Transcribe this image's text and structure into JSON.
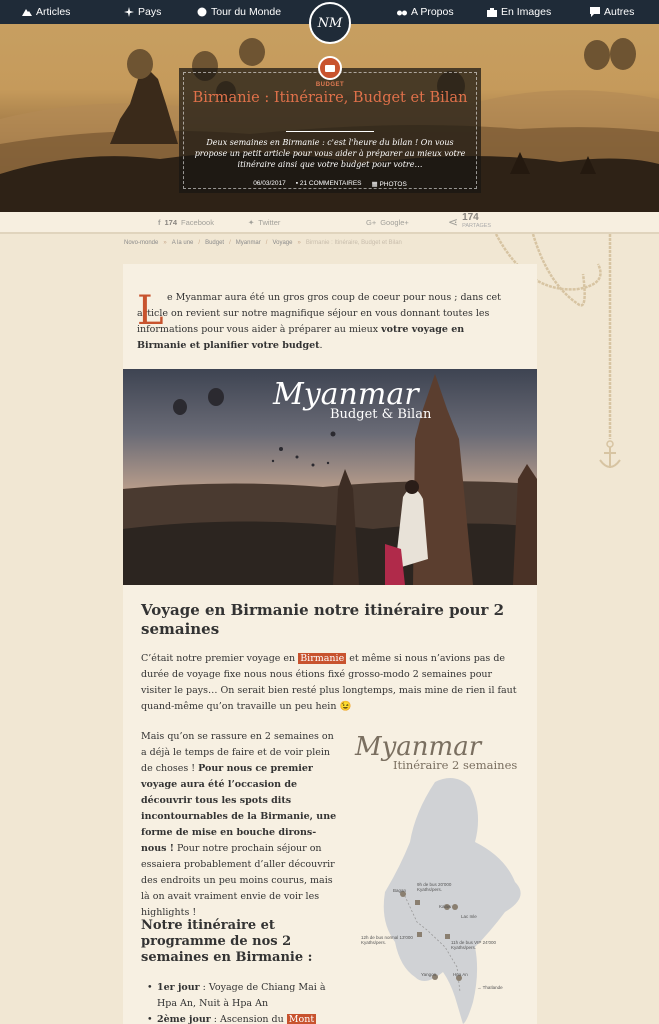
{
  "nav": {
    "articles": "Articles",
    "pays": "Pays",
    "tour": "Tour du Monde",
    "apropos": "A Propos",
    "images": "En Images",
    "autres": "Autres",
    "logo": "NM"
  },
  "hero": {
    "category": "BUDGET",
    "title": "Birmanie : Itinéraire, Budget et Bilan",
    "description": "Deux semaines en Birmanie : c'est l'heure du bilan ! On vous propose un petit article pour vous aider à préparer au mieux votre itinéraire ainsi que votre budget pour votre…",
    "date": "06/03/2017",
    "comments": "21 COMMENTAIRES",
    "photos": "PHOTOS"
  },
  "share": {
    "facebook_count": "174",
    "facebook_label": "Facebook",
    "twitter": "Twitter",
    "google": "Google+",
    "total": "174",
    "total_label": "PARTAGES"
  },
  "breadcrumb": {
    "home": "Novo-monde",
    "items": [
      "A la une",
      "Budget",
      "Myanmar",
      "Voyage"
    ],
    "current": "Birmanie : Itinéraire, Budget et Bilan"
  },
  "article": {
    "dropcap": "L",
    "intro_plain": "e Myanmar aura été un gros gros coup de coeur pour nous ; dans cet article on revient sur notre magnifique séjour en vous donnant toutes les informations pour vous aider à préparer au mieux ",
    "intro_bold": "votre voyage en Birmanie et planifier votre budget",
    "intro_end": ".",
    "photo_title": "Myanmar",
    "photo_sub": "Budget & Bilan",
    "h2": "Voyage en Birmanie notre itinéraire pour 2 semaines",
    "p1_a": "C’était notre premier voyage en ",
    "p1_link": "Birmanie",
    "p1_b": " et même si nous n’avions pas de durée de voyage fixe nous nous étions fixé grosso-modo 2 semaines pour visiter le pays… On serait bien resté plus longtemps, mais mine de rien il faut quand-même qu’on travaille un peu hein 😉",
    "p2_a": "Mais qu’on se rassure en 2 semaines on a déjà le temps de faire et de voir plein de choses ! ",
    "p2_bold": "Pour nous ce premier voyage aura été l’occasion de découvrir tous les spots dits incontournables de la Birmanie, une forme de mise en bouche dirons-nous !",
    "p2_b": " Pour notre prochain séjour on essaiera probablement d’aller découvrir des endroits un peu moins courus, mais là on avait vraiment envie de voir les highlights !",
    "h3": "Notre itinéraire et programme de nos 2 semaines en Birmanie :",
    "list1_bold": "1er jour",
    "list1_text": " : Voyage de Chiang Mai à Hpa An, Nuit à Hpa An",
    "list2_bold": "2ème jour",
    "list2_text": " : Ascension du ",
    "list2_link": "Mont"
  },
  "map": {
    "title": "Myanmar",
    "subtitle": "Itinéraire 2 semaines",
    "bagan": "Bagan",
    "bagan_note": "9h de bus 20'000 Kyaths/pers.",
    "kalaw": "Kalaw",
    "inle": "Lac Inle",
    "bus_normal": "12h de bus normal 13'000 Kyaths/pers.",
    "bus_vip": "11h de bus VIP 24'000 Kyaths/pers.",
    "yangon": "Yangon",
    "hpaan": "Hpa An",
    "thailande": "→ Thaïlande"
  }
}
